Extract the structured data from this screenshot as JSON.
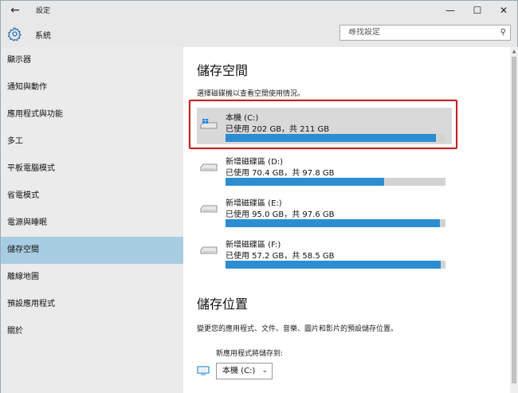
{
  "titlebar": {
    "back_icon": "back-arrow-icon",
    "title": "設定",
    "minimize": "—",
    "maximize": "☐",
    "close": "✕"
  },
  "header": {
    "icon": "gear-icon",
    "title": "系統",
    "search_placeholder": "尋找設定",
    "search_icon": "search-icon"
  },
  "sidebar": {
    "items": [
      {
        "label": "顯示器"
      },
      {
        "label": "通知與動作"
      },
      {
        "label": "應用程式與功能"
      },
      {
        "label": "多工"
      },
      {
        "label": "平板電腦模式"
      },
      {
        "label": "省電模式"
      },
      {
        "label": "電源與睡眠"
      },
      {
        "label": "儲存空間",
        "selected": true
      },
      {
        "label": "離線地圖"
      },
      {
        "label": "預設應用程式"
      },
      {
        "label": "關於"
      }
    ]
  },
  "storage": {
    "title": "儲存空間",
    "description": "選擇磁碟機以查看空間使用情況。",
    "drives": [
      {
        "name": "本機 (C:)",
        "usage": "已使用 202 GB，共 211 GB",
        "used": 202,
        "total": 211,
        "icon": "windows-drive-icon",
        "highlighted": true
      },
      {
        "name": "新增磁碟區 (D:)",
        "usage": "已使用 70.4 GB，共 97.8 GB",
        "used": 70.4,
        "total": 97.8,
        "icon": "drive-icon"
      },
      {
        "name": "新增磁碟區 (E:)",
        "usage": "已使用 95.0 GB，共 97.6 GB",
        "used": 95.0,
        "total": 97.6,
        "icon": "drive-icon"
      },
      {
        "name": "新增磁碟區 (F:)",
        "usage": "已使用 57.2 GB，共 58.5 GB",
        "used": 57.2,
        "total": 58.5,
        "icon": "drive-icon"
      }
    ]
  },
  "locations": {
    "title": "儲存位置",
    "description": "變更您的應用程式、文件、音樂、圖片和影片的預設儲存位置。",
    "new_apps_label": "新應用程式將儲存到:",
    "new_apps_value": "本機 (C:)",
    "icon": "monitor-icon"
  },
  "colors": {
    "accent": "#2c8dd1",
    "selected_nav": "#a8cde2",
    "highlight_frame": "#cc1f24"
  }
}
